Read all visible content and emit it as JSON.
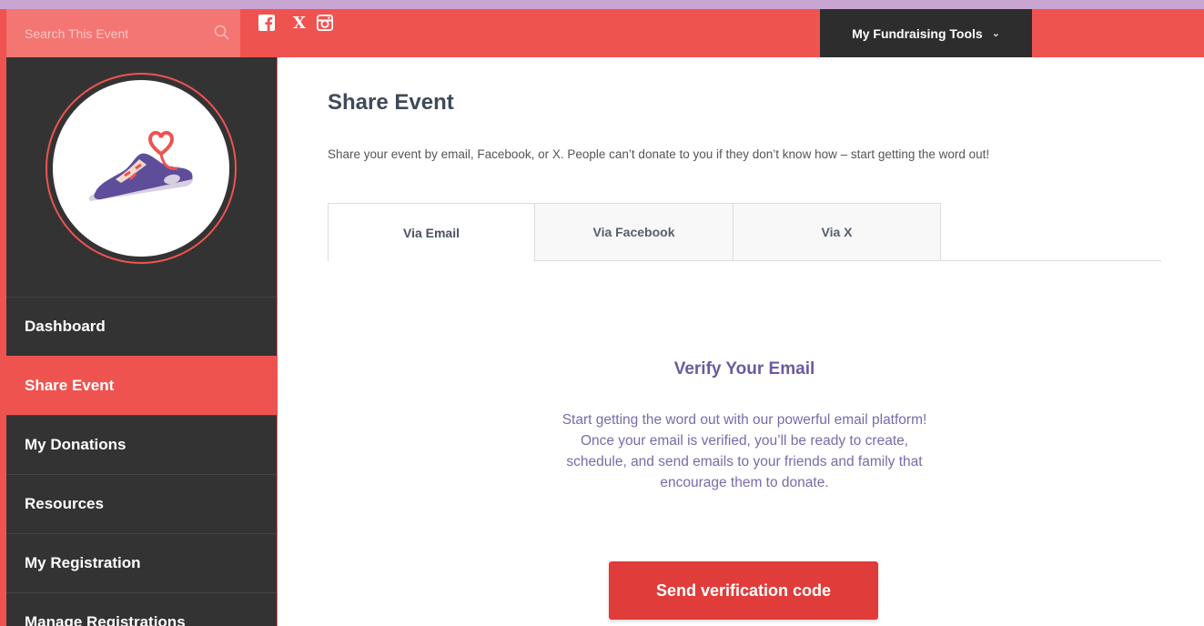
{
  "colors": {
    "brand": "#ef5350",
    "sidebar": "#333333",
    "dark_button": "#2d2d2d",
    "accent_purple": "#6b5aa0",
    "top_strip": "#c9a5d2"
  },
  "header": {
    "search_placeholder": "Search This Event",
    "social_icons": [
      "facebook-icon",
      "x-icon",
      "instagram-icon"
    ],
    "x_glyph": "X",
    "tools_label": "My Fundraising Tools",
    "tools_chevron": "⌄"
  },
  "sidebar": {
    "avatar_icon": "sneaker-heart-icon",
    "items": [
      {
        "label": "Dashboard",
        "active": false
      },
      {
        "label": "Share Event",
        "active": true
      },
      {
        "label": "My Donations",
        "active": false
      },
      {
        "label": "Resources",
        "active": false
      },
      {
        "label": "My Registration",
        "active": false
      },
      {
        "label": "Manage Registrations",
        "active": false
      }
    ]
  },
  "main": {
    "title": "Share Event",
    "intro": "Share your event by email, Facebook, or X. People can’t donate to you if they don’t know how – start getting the word out!",
    "tabs": [
      {
        "label": "Via Email",
        "active": true
      },
      {
        "label": "Via Facebook",
        "active": false
      },
      {
        "label": "Via X",
        "active": false
      }
    ],
    "verify": {
      "title": "Verify Your Email",
      "text": "Start getting the word out with our powerful email platform! Once your email is verified, you’ll be ready to create, schedule, and send emails to your friends and family that encourage them to donate.",
      "button_label": "Send verification code"
    }
  }
}
